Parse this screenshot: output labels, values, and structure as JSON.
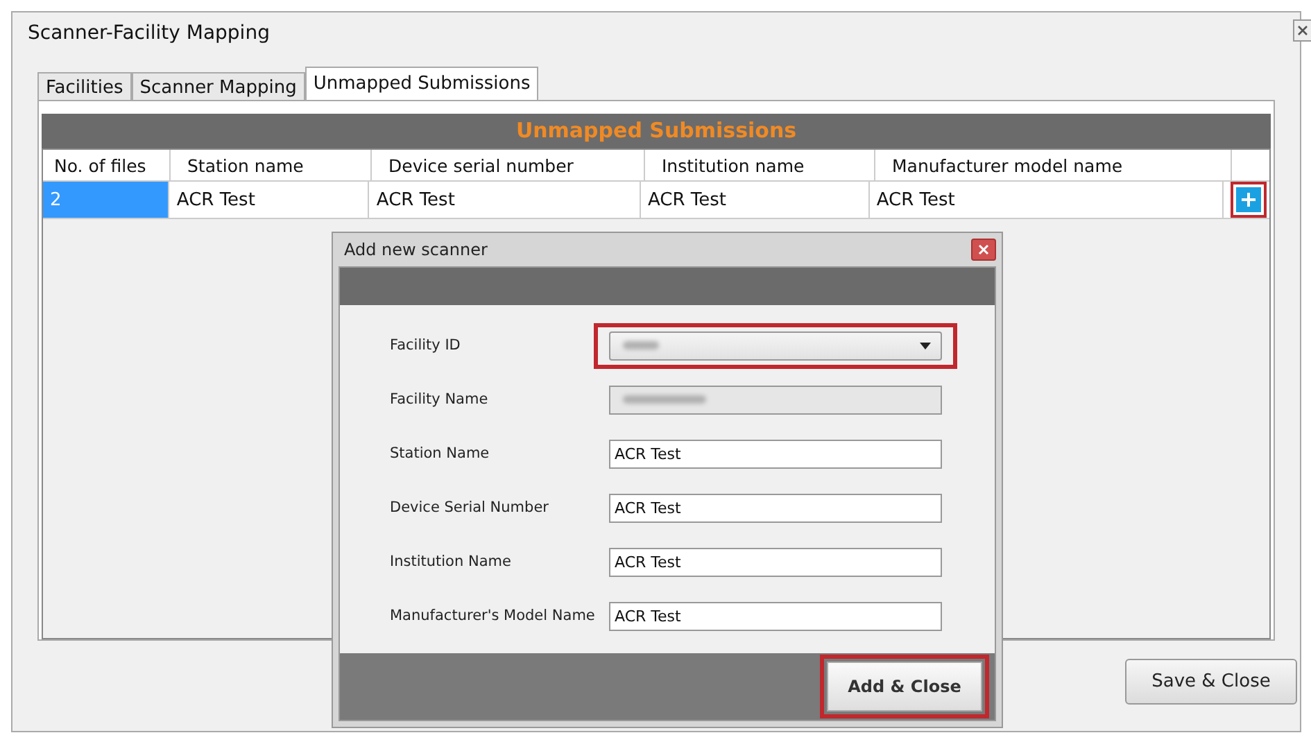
{
  "window": {
    "title": "Scanner-Facility Mapping"
  },
  "tabs": [
    {
      "label": "Facilities",
      "selected": false
    },
    {
      "label": "Scanner Mapping",
      "selected": false
    },
    {
      "label": "Unmapped Submissions",
      "selected": true
    }
  ],
  "panel": {
    "title": "Unmapped Submissions"
  },
  "table": {
    "columns": [
      "No. of files",
      "Station name",
      "Device serial number",
      "Institution name",
      "Manufacturer model name"
    ],
    "rows": [
      {
        "cells": [
          {
            "text": "2",
            "selected": true
          },
          {
            "text": "ACR Test",
            "selected": false
          },
          {
            "text": "ACR Test",
            "selected": false
          },
          {
            "text": "ACR Test",
            "selected": false
          },
          {
            "text": "ACR Test",
            "selected": false
          }
        ],
        "add_highlighted": true
      }
    ]
  },
  "buttons": [
    "Save & Close"
  ],
  "dialog": {
    "title": "Add new scanner",
    "fields": [
      {
        "label": "Facility ID",
        "kind": "dropdown",
        "blurred": true,
        "highlighted": true
      },
      {
        "label": "Facility Name",
        "kind": "readonly",
        "blurred": true,
        "highlighted": false
      },
      {
        "label": "Station Name",
        "kind": "text",
        "value": "ACR Test",
        "highlighted": false
      },
      {
        "label": "Device Serial Number",
        "kind": "text",
        "value": "ACR Test",
        "highlighted": false
      },
      {
        "label": "Institution Name",
        "kind": "text",
        "value": "ACR Test",
        "highlighted": false
      },
      {
        "label": "Manufacturer's Model Name",
        "kind": "text",
        "value": "ACR Test",
        "highlighted": false
      }
    ],
    "button": {
      "label": "Add & Close",
      "highlighted": true
    }
  }
}
